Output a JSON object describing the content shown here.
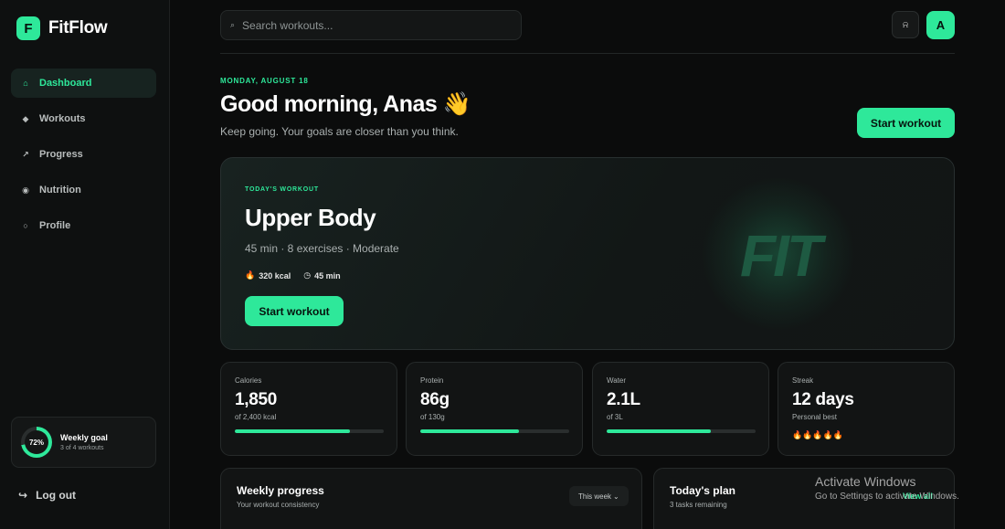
{
  "brand": {
    "mark": "F",
    "name": "FitFlow"
  },
  "sidebar": {
    "items": [
      {
        "label": "Dashboard",
        "icon": "⌂",
        "active": true
      },
      {
        "label": "Workouts",
        "icon": "◆"
      },
      {
        "label": "Progress",
        "icon": "↗"
      },
      {
        "label": "Nutrition",
        "icon": "◉"
      },
      {
        "label": "Profile",
        "icon": "○"
      }
    ],
    "goal": {
      "percent_label": "72%",
      "percent": 72,
      "title": "Weekly goal",
      "sub": "3 of 4 workouts"
    },
    "logout": {
      "icon": "↪",
      "label": "Log out"
    }
  },
  "header": {
    "search_placeholder": "Search workouts...",
    "search_icon": "⌕",
    "bell_icon": "⍾",
    "avatar_initial": "A"
  },
  "greeting": {
    "date": "MONDAY, AUGUST 18",
    "title": "Good morning, Anas 👋",
    "subtitle": "Keep going. Your goals are closer than you think.",
    "cta": "Start workout"
  },
  "hero": {
    "eyebrow": "TODAY'S WORKOUT",
    "title": "Upper Body",
    "meta": "45 min · 8 exercises · Moderate",
    "calories": "320 kcal",
    "calories_icon": "🔥",
    "duration": "45 min",
    "duration_icon": "◷",
    "cta": "Start workout",
    "art_text": "FIT"
  },
  "stats": [
    {
      "label": "Calories",
      "value": "1,850",
      "sub": "of 2,400 kcal",
      "progress": 0.77
    },
    {
      "label": "Protein",
      "value": "86g",
      "sub": "of 130g",
      "progress": 0.66
    },
    {
      "label": "Water",
      "value": "2.1L",
      "sub": "of 3L",
      "progress": 0.7
    },
    {
      "label": "Streak",
      "value": "12 days",
      "sub": "Personal best",
      "flames": "🔥🔥🔥🔥🔥"
    }
  ],
  "panels": {
    "weekly": {
      "title": "Weekly progress",
      "sub": "Your workout consistency",
      "range": "This week",
      "range_icon": "⌄"
    },
    "plan": {
      "title": "Today's plan",
      "sub": "3 tasks remaining",
      "link": "View all"
    }
  },
  "watermark": {
    "title": "Activate Windows",
    "sub": "Go to Settings to activate Windows."
  },
  "colors": {
    "accent": "#2ee89a",
    "background": "#0b0c0c",
    "card": "#121414"
  }
}
